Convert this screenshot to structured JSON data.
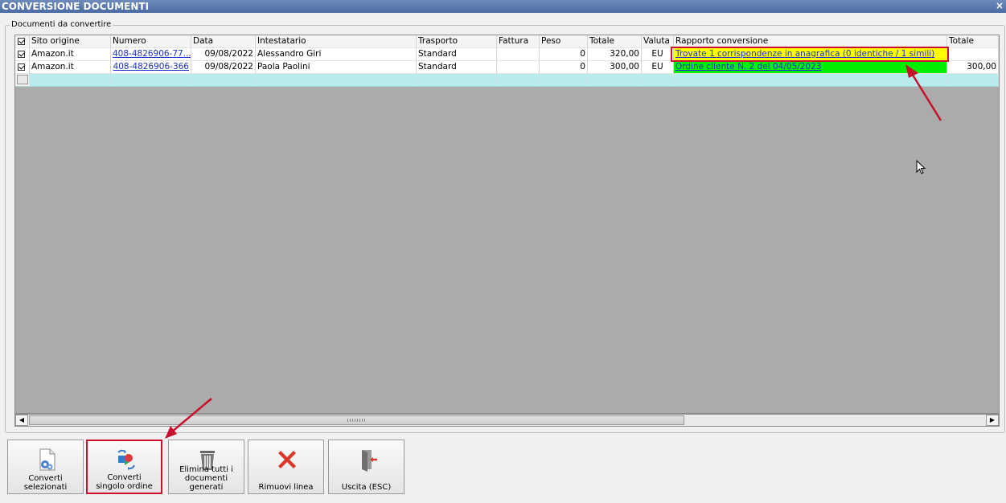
{
  "window": {
    "title": "CONVERSIONE DOCUMENTI",
    "close_glyph": "×"
  },
  "groupbox": {
    "label": "Documenti da convertire"
  },
  "grid": {
    "columns": {
      "sito": "Sito origine",
      "numero": "Numero",
      "data": "Data",
      "intestatario": "Intestatario",
      "trasporto": "Trasporto",
      "fattura": "Fattura",
      "peso": "Peso",
      "totale": "Totale",
      "valuta": "Valuta",
      "rapporto": "Rapporto conversione",
      "totale2": "Totale"
    },
    "rows": [
      {
        "checked": true,
        "sito": "Amazon.it",
        "numero": "408-4826906-77...",
        "data": "09/08/2022",
        "intestatario": "Alessandro Giri",
        "trasporto": "Standard",
        "fattura": "",
        "peso": "0",
        "totale": "320,00",
        "valuta": "EU",
        "rapporto": "Trovate 1 corrispondenze in anagrafica (0 identiche / 1 simili)",
        "rapporto_status": "yellow",
        "totale2": ""
      },
      {
        "checked": true,
        "sito": "Amazon.it",
        "numero": "408-4826906-366",
        "data": "09/08/2022",
        "intestatario": "Paola Paolini",
        "trasporto": "Standard",
        "fattura": "",
        "peso": "0",
        "totale": "300,00",
        "valuta": "EU",
        "rapporto": "Ordine cliente N. 2 del 04/05/2023",
        "rapporto_status": "green",
        "totale2": "300,00"
      }
    ]
  },
  "scrollbar": {
    "left_glyph": "◀",
    "right_glyph": "▶"
  },
  "toolbar": {
    "buttons": [
      {
        "label": "Converti selezionati",
        "icon": "document-gear-icon"
      },
      {
        "label": "Converti singolo ordine",
        "icon": "convert-shapes-icon"
      },
      {
        "label": "Elimina tutti i documenti generati",
        "icon": "trash-icon"
      },
      {
        "label": "Rimuovi linea",
        "icon": "red-x-icon"
      },
      {
        "label": "Uscita (ESC)",
        "icon": "exit-door-icon"
      }
    ]
  },
  "colors": {
    "highlight": "#c8102e",
    "status_yellow": "#ffff00",
    "status_green": "#00ee00",
    "new_row": "#b8ecec"
  }
}
